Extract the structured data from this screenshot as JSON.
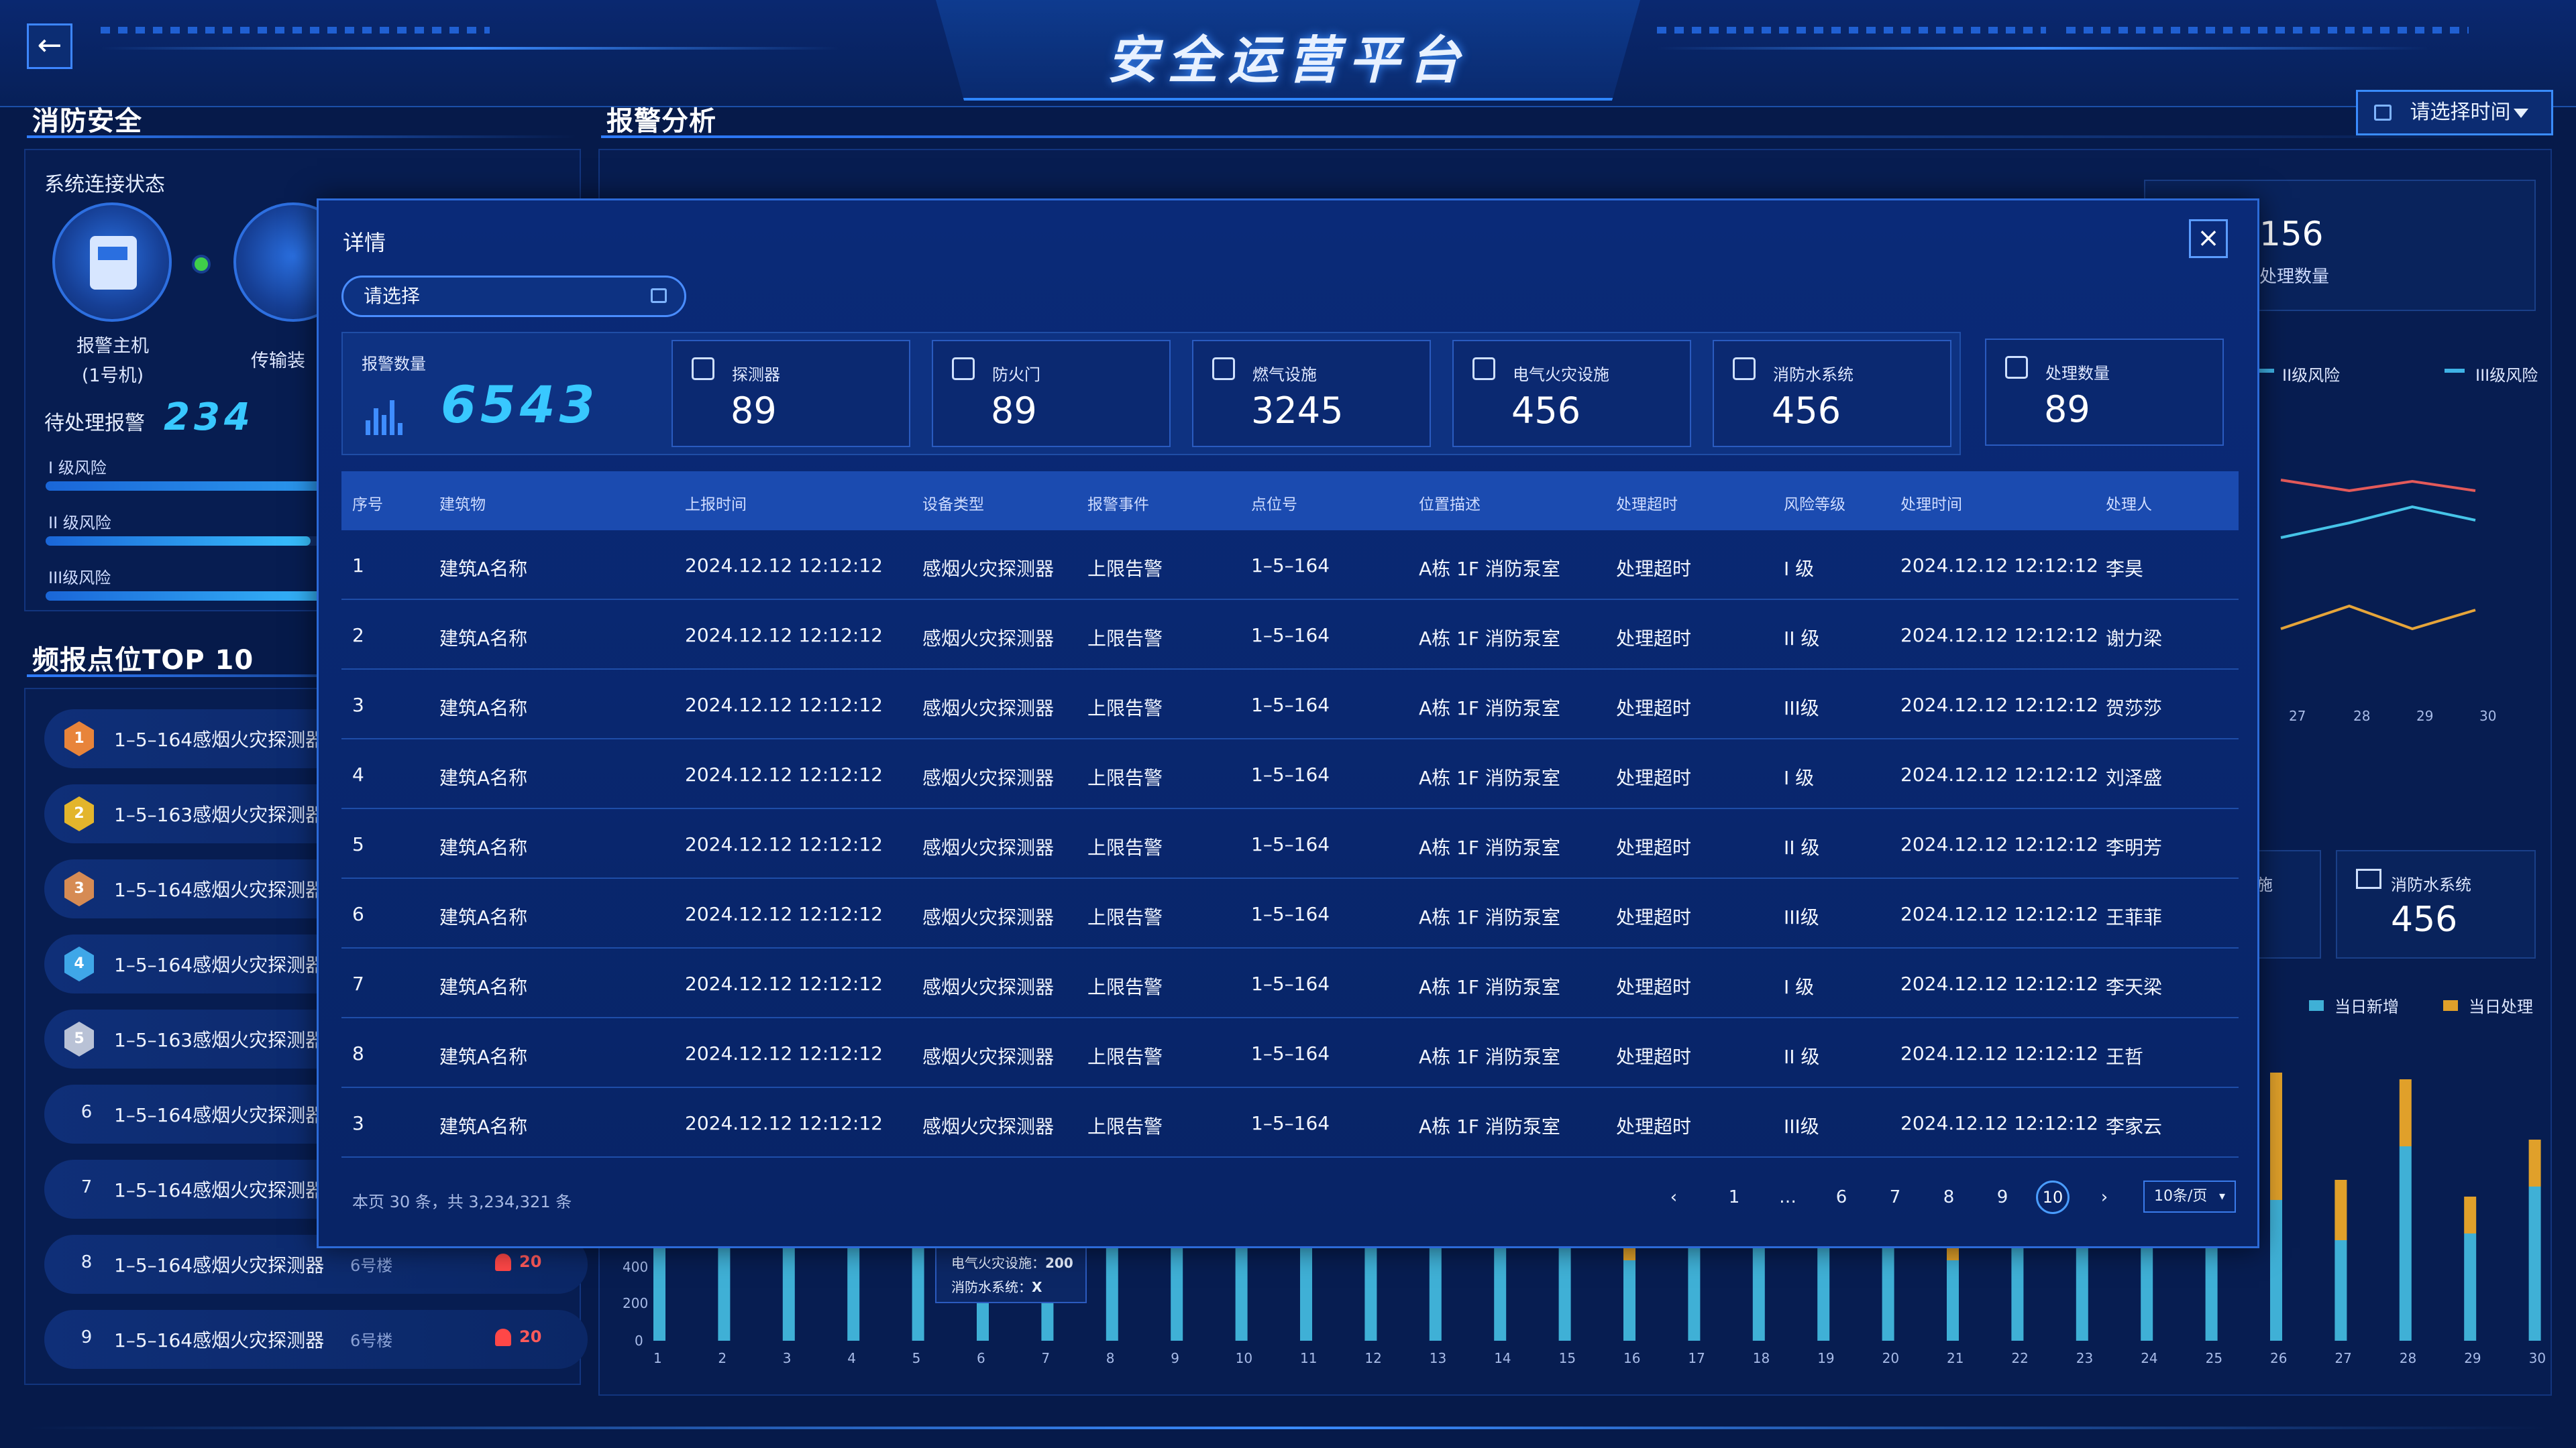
{
  "header": {
    "title": "安全运营平台",
    "back_icon": "arrow-left-icon",
    "time_select": "请选择时间"
  },
  "left": {
    "fire_title": "消防安全",
    "connection_title": "系统连接状态",
    "devices": [
      {
        "name": "报警主机",
        "sub": "(1号机)"
      },
      {
        "name": "传输装",
        "sub": ""
      }
    ],
    "pending_label": "待处理报警",
    "pending_value": "234",
    "risks": [
      {
        "label": "I 级风险",
        "fill": 0.95
      },
      {
        "label": "II 级风险",
        "fill": 0.5
      },
      {
        "label": "III级风险",
        "fill": 0.6
      }
    ],
    "top10_title": "频报点位TOP 10",
    "top10": [
      {
        "rank": "1",
        "name": "1–5–164感烟火灾探测器",
        "floor": "",
        "value": ""
      },
      {
        "rank": "2",
        "name": "1–5–163感烟火灾探测器",
        "floor": "",
        "value": ""
      },
      {
        "rank": "3",
        "name": "1–5–164感烟火灾探测器",
        "floor": "",
        "value": ""
      },
      {
        "rank": "4",
        "name": "1–5–164感烟火灾探测器",
        "floor": "",
        "value": ""
      },
      {
        "rank": "5",
        "name": "1–5–163感烟火灾探测器",
        "floor": "",
        "value": ""
      },
      {
        "rank": "6",
        "name": "1–5–164感烟火灾探测器",
        "floor": "",
        "value": ""
      },
      {
        "rank": "7",
        "name": "1–5–164感烟火灾探测器",
        "floor": "",
        "value": ""
      },
      {
        "rank": "8",
        "name": "1–5–164感烟火灾探测器",
        "floor": "6号楼",
        "value": "20"
      },
      {
        "rank": "9",
        "name": "1–5–164感烟火灾探测器",
        "floor": "6号楼",
        "value": "20"
      }
    ],
    "medal_colors": [
      "#e8843a",
      "#e3b52c",
      "#d68b54",
      "#3fa7e8",
      "#b9c2d6"
    ]
  },
  "analysis": {
    "title": "报警分析",
    "handled_kpi": {
      "value": "156",
      "label": "处理数量"
    },
    "legend_risk": [
      "II级风险",
      "III级风险"
    ],
    "line_x": [
      "27",
      "28",
      "29",
      "30"
    ],
    "water_kpi": {
      "label": "消防水系统",
      "value": "456"
    },
    "partial_label": "施",
    "bar_legend": [
      "当日新增",
      "当日处理"
    ],
    "bar_y": [
      "400",
      "200",
      "0"
    ],
    "bar_x": [
      "1",
      "2",
      "3",
      "4",
      "5",
      "6",
      "7",
      "8",
      "9",
      "10",
      "11",
      "12",
      "13",
      "14",
      "15",
      "16",
      "17",
      "18",
      "19",
      "20",
      "21",
      "22",
      "23",
      "24",
      "25",
      "26",
      "27",
      "28",
      "29",
      "30"
    ],
    "tooltip": {
      "line1": "电气火灾设施：",
      "val1": "200",
      "line2": "消防水系统：",
      "val2": "X"
    }
  },
  "modal": {
    "title": "详情",
    "select_placeholder": "请选择",
    "alarm": {
      "label": "报警数量",
      "value": "6543"
    },
    "stats": [
      {
        "label": "探测器",
        "value": "89",
        "icon": "gear-icon"
      },
      {
        "label": "防火门",
        "value": "89",
        "icon": "door-icon"
      },
      {
        "label": "燃气设施",
        "value": "3245",
        "icon": "gas-icon"
      },
      {
        "label": "电气火灾设施",
        "value": "456",
        "icon": "electric-icon"
      },
      {
        "label": "消防水系统",
        "value": "456",
        "icon": "water-system-icon"
      }
    ],
    "handled": {
      "label": "处理数量",
      "value": "89",
      "icon": "clipboard-icon"
    },
    "columns": [
      "序号",
      "建筑物",
      "上报时间",
      "设备类型",
      "报警事件",
      "点位号",
      "位置描述",
      "处理超时",
      "风险等级",
      "处理时间",
      "处理人"
    ],
    "rows": [
      [
        "1",
        "建筑A名称",
        "2024.12.12 12:12:12",
        "感烟火灾探测器",
        "上限告警",
        "1–5–164",
        "A栋 1F 消防泵室",
        "处理超时",
        "I 级",
        "2024.12.12 12:12:12",
        "李昊"
      ],
      [
        "2",
        "建筑A名称",
        "2024.12.12 12:12:12",
        "感烟火灾探测器",
        "上限告警",
        "1–5–164",
        "A栋 1F 消防泵室",
        "处理超时",
        "II 级",
        "2024.12.12 12:12:12",
        "谢力梁"
      ],
      [
        "3",
        "建筑A名称",
        "2024.12.12 12:12:12",
        "感烟火灾探测器",
        "上限告警",
        "1–5–164",
        "A栋 1F 消防泵室",
        "处理超时",
        "III级",
        "2024.12.12 12:12:12",
        "贺莎莎"
      ],
      [
        "4",
        "建筑A名称",
        "2024.12.12 12:12:12",
        "感烟火灾探测器",
        "上限告警",
        "1–5–164",
        "A栋 1F 消防泵室",
        "处理超时",
        "I 级",
        "2024.12.12 12:12:12",
        "刘泽盛"
      ],
      [
        "5",
        "建筑A名称",
        "2024.12.12 12:12:12",
        "感烟火灾探测器",
        "上限告警",
        "1–5–164",
        "A栋 1F 消防泵室",
        "处理超时",
        "II 级",
        "2024.12.12 12:12:12",
        "李明芳"
      ],
      [
        "6",
        "建筑A名称",
        "2024.12.12 12:12:12",
        "感烟火灾探测器",
        "上限告警",
        "1–5–164",
        "A栋 1F 消防泵室",
        "处理超时",
        "III级",
        "2024.12.12 12:12:12",
        "王菲菲"
      ],
      [
        "7",
        "建筑A名称",
        "2024.12.12 12:12:12",
        "感烟火灾探测器",
        "上限告警",
        "1–5–164",
        "A栋 1F 消防泵室",
        "处理超时",
        "I 级",
        "2024.12.12 12:12:12",
        "李天梁"
      ],
      [
        "8",
        "建筑A名称",
        "2024.12.12 12:12:12",
        "感烟火灾探测器",
        "上限告警",
        "1–5–164",
        "A栋 1F 消防泵室",
        "处理超时",
        "II 级",
        "2024.12.12 12:12:12",
        "王哲"
      ],
      [
        "3",
        "建筑A名称",
        "2024.12.12 12:12:12",
        "感烟火灾探测器",
        "上限告警",
        "1–5–164",
        "A栋 1F 消防泵室",
        "处理超时",
        "III级",
        "2024.12.12 12:12:12",
        "李家云"
      ]
    ],
    "pager": {
      "summary": "本页 30 条，共 3,234,321 条",
      "pages": [
        "1",
        "…",
        "6",
        "7",
        "8",
        "9"
      ],
      "current": "10",
      "page_size": "10条/页"
    }
  },
  "colors": {
    "accent": "#38c8ff",
    "bar_new": "#3fb0d6",
    "bar_handled": "#e0a02a",
    "line_red": "#e35a5a",
    "line_cyan": "#46c4e8",
    "line_orange": "#e6a53a"
  }
}
